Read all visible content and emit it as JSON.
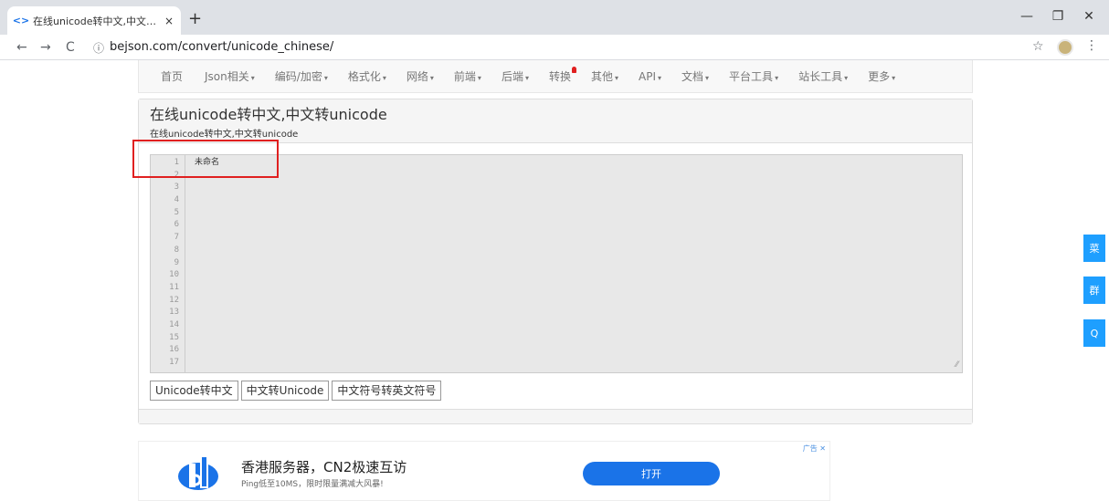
{
  "browser": {
    "tab_title": "在线unicode转中文,中文转unicc",
    "tab_close": "×",
    "new_tab": "+",
    "url": "bejson.com/convert/unicode_chinese/",
    "win_minimize": "—",
    "win_restore": "❐",
    "win_close": "✕",
    "back": "←",
    "forward": "→",
    "reload": "C",
    "info": "ⓘ",
    "star": "☆",
    "menu": "⋮"
  },
  "nav": {
    "items": [
      {
        "label": "首页",
        "caret": ""
      },
      {
        "label": "Json相关",
        "caret": "▾"
      },
      {
        "label": "编码/加密",
        "caret": "▾"
      },
      {
        "label": "格式化",
        "caret": "▾"
      },
      {
        "label": "网络",
        "caret": "▾"
      },
      {
        "label": "前端",
        "caret": "▾"
      },
      {
        "label": "后端",
        "caret": "▾"
      },
      {
        "label": "转换",
        "caret": ""
      },
      {
        "label": "其他",
        "caret": "▾"
      },
      {
        "label": "API",
        "caret": "▾"
      },
      {
        "label": "文档",
        "caret": "▾"
      },
      {
        "label": "平台工具",
        "caret": "▾"
      },
      {
        "label": "站长工具",
        "caret": "▾"
      },
      {
        "label": "更多",
        "caret": "▾"
      }
    ]
  },
  "panel": {
    "title": "在线unicode转中文,中文转unicode",
    "subtitle": "在线unicode转中文,中文转unicode"
  },
  "editor": {
    "line_numbers": [
      "1",
      "2",
      "3",
      "4",
      "5",
      "6",
      "7",
      "8",
      "9",
      "10",
      "11",
      "12",
      "13",
      "14",
      "15",
      "16",
      "17"
    ],
    "content": "未命名",
    "resize": "⁄⁄"
  },
  "buttons": {
    "unicode_to_cn": "Unicode转中文",
    "cn_to_unicode": "中文转Unicode",
    "cn_sym_to_en": "中文符号转英文符号"
  },
  "side": {
    "menu": "菜",
    "group": "群",
    "qq": "Q"
  },
  "ad": {
    "label": "广告 ✕",
    "title": "香港服务器，CN2极速互访",
    "desc": "Ping低至10MS，限时限量满减大风暴!",
    "button": "打开"
  },
  "colors": {
    "accent": "#1e9fff",
    "highlight": "#e02020",
    "ad_button": "#1a73e8"
  }
}
